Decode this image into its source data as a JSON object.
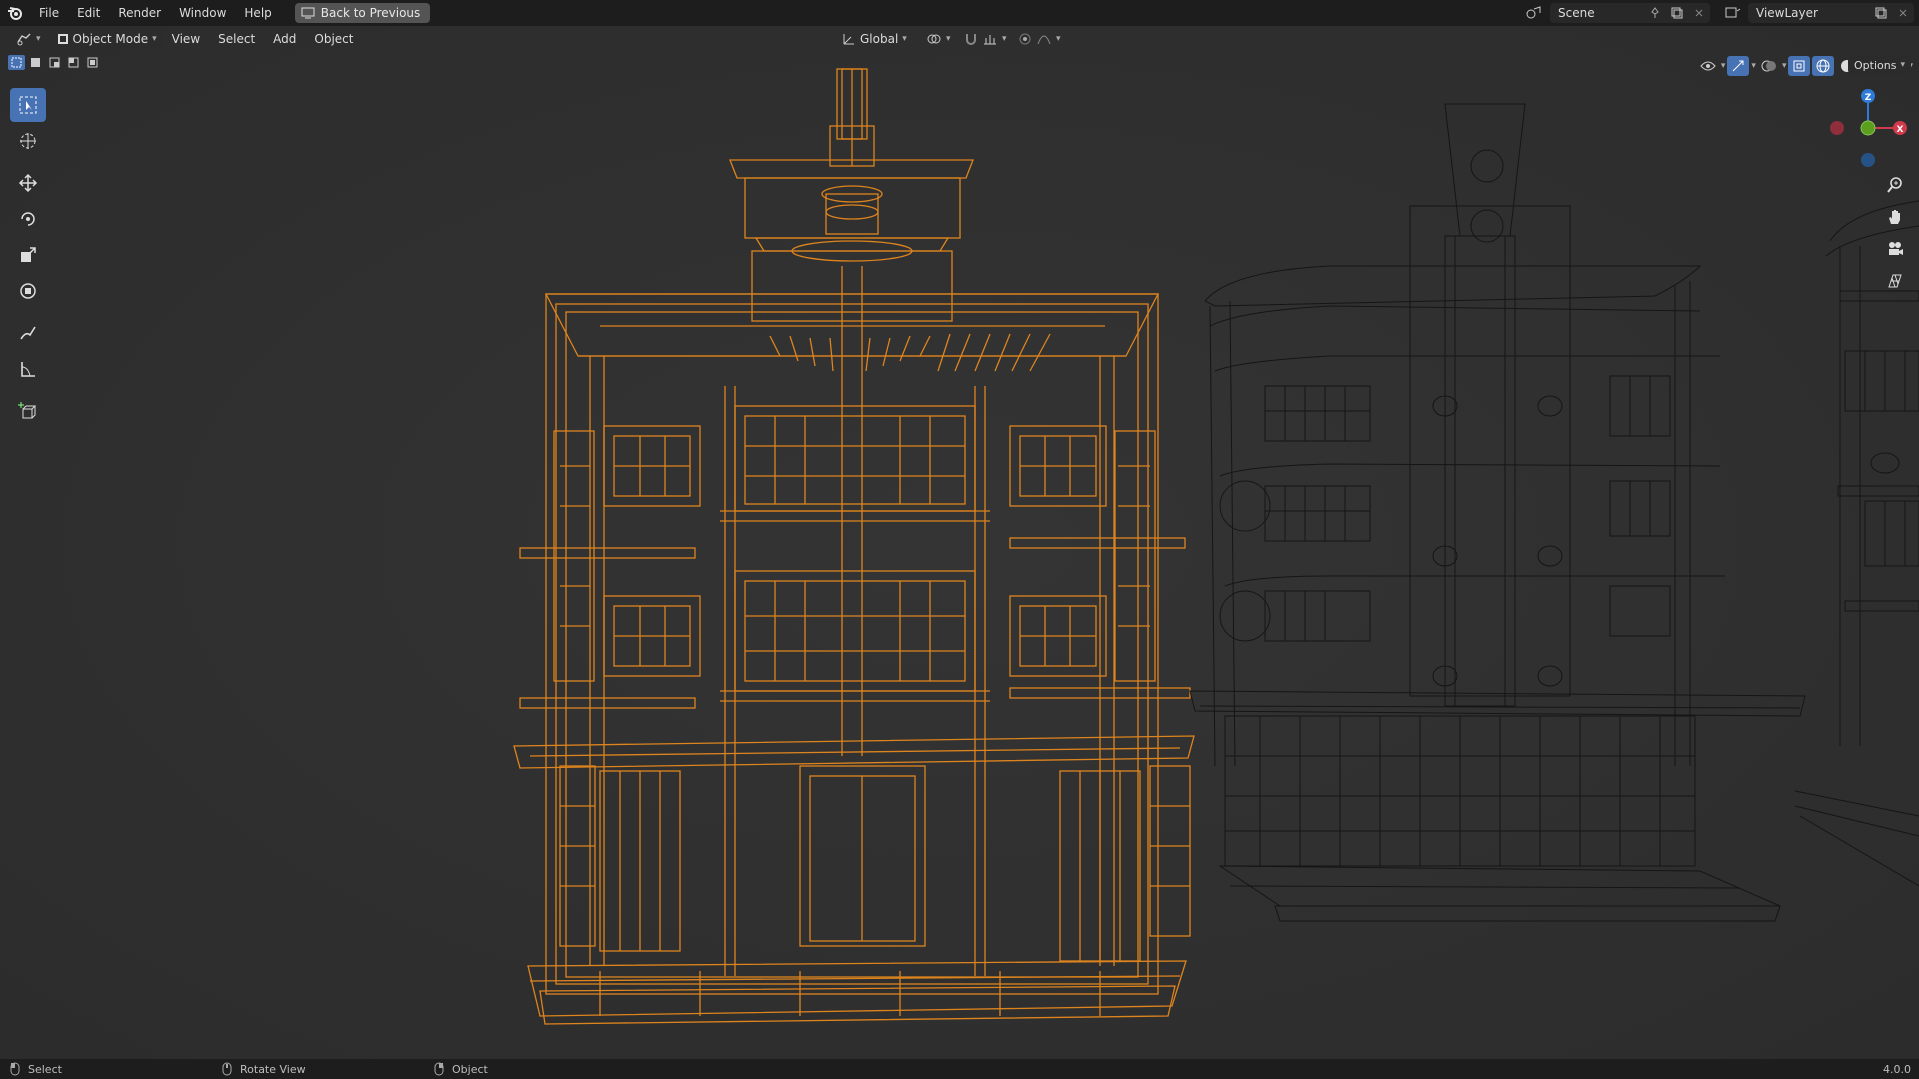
{
  "topbar": {
    "menu": [
      "File",
      "Edit",
      "Render",
      "Window",
      "Help"
    ],
    "back_button": "Back to Previous",
    "scene": "Scene",
    "view_layer": "ViewLayer"
  },
  "header": {
    "mode": "Object Mode",
    "menus": [
      "View",
      "Select",
      "Add",
      "Object"
    ],
    "transform_orientation": "Global",
    "options": "Options"
  },
  "gizmo": {
    "z": "Z",
    "x": "X"
  },
  "status": {
    "select": "Select",
    "rotate": "Rotate View",
    "object": "Object",
    "version": "4.0.0"
  },
  "colors": {
    "selected_wire": "#e8891d",
    "unselected_wire": "#000000",
    "accent": "#4772b3",
    "background": "#303030"
  }
}
